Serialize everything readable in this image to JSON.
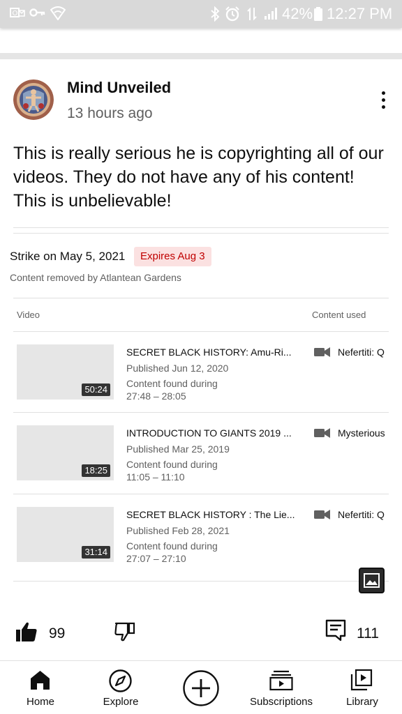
{
  "status_bar": {
    "battery": "42%",
    "time": "12:27 PM",
    "icons": [
      "outlook-icon",
      "vpn-key-icon",
      "wifi-icon",
      "bluetooth-icon",
      "alarm-icon",
      "data-arrows-icon",
      "signal-icon",
      "battery-icon"
    ]
  },
  "post": {
    "author": "Mind Unveiled",
    "time_ago": "13 hours ago",
    "text": "This is really serious he is copyrighting all of our videos. They do not have any of his content! This is unbelievable!"
  },
  "strike": {
    "title": "Strike on May 5, 2021",
    "expires": "Expires Aug 3",
    "description": "Content removed by Atlantean Gardens",
    "col_video": "Video",
    "col_content": "Content used"
  },
  "videos": [
    {
      "title": "SECRET BLACK HISTORY: Amu-Ri...",
      "published": "Published Jun 12, 2020",
      "found": "Content found during",
      "range": "27:48 – 28:05",
      "duration": "50:24",
      "content_used": "Nefertiti: Q"
    },
    {
      "title": "INTRODUCTION TO GIANTS 2019 ...",
      "published": "Published Mar 25, 2019",
      "found": "Content found during",
      "range": "11:05 – 11:10",
      "duration": "18:25",
      "content_used": "Mysterious"
    },
    {
      "title": "SECRET BLACK HISTORY : The Lie...",
      "published": "Published Feb 28, 2021",
      "found": "Content found during",
      "range": "27:07 – 27:10",
      "duration": "31:14",
      "content_used": "Nefertiti: Q"
    }
  ],
  "actions": {
    "likes": "99",
    "comments": "111"
  },
  "nav": {
    "home": "Home",
    "explore": "Explore",
    "subscriptions": "Subscriptions",
    "library": "Library"
  },
  "colors": {
    "status_bar": "#d9d9d9",
    "badge_bg": "#fbe1e1",
    "badge_text": "#c00000",
    "secondary_text": "#606060"
  }
}
